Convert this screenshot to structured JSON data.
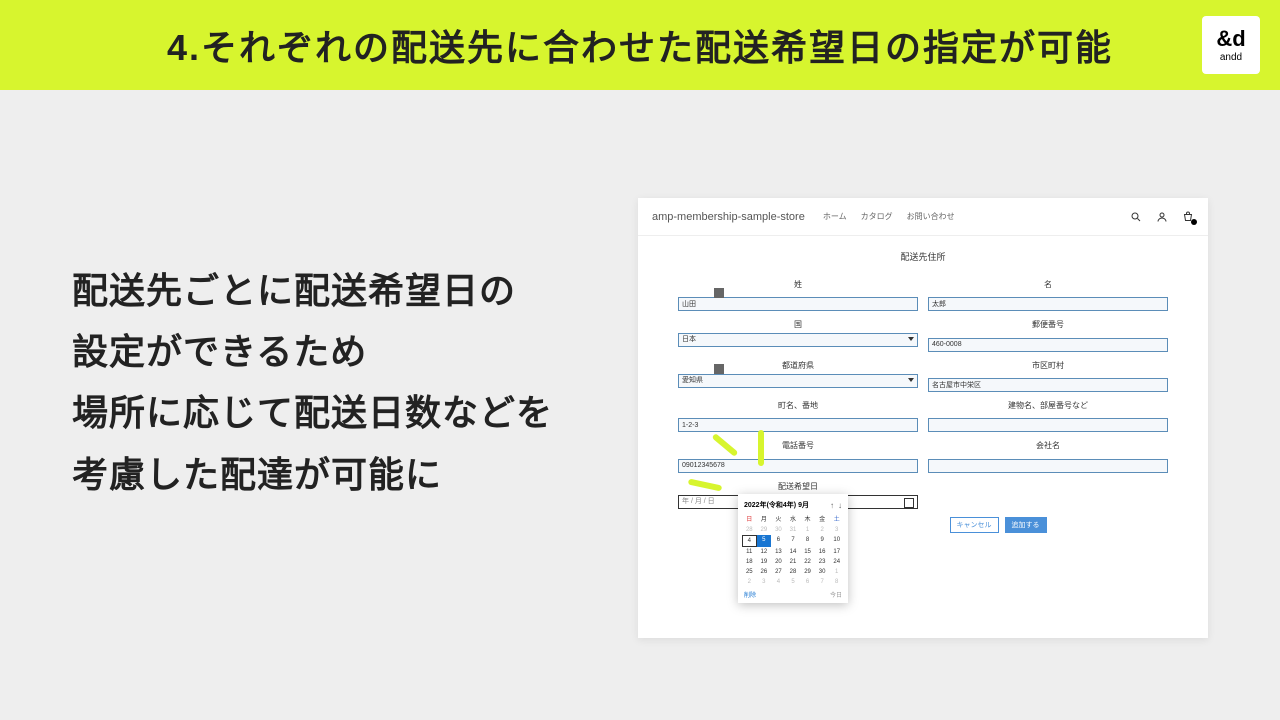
{
  "header": {
    "title": "4.それぞれの配送先に合わせた配送希望日の指定が可能"
  },
  "logo": {
    "mark": "&d",
    "sub": "andd"
  },
  "bodyText": "配送先ごとに配送希望日の\n設定ができるため\n場所に応じて配送日数などを\n考慮した配達が可能に",
  "shot": {
    "storeName": "amp-membership-sample-store",
    "nav": [
      "ホーム",
      "カタログ",
      "お問い合わせ"
    ],
    "formTitle": "配送先住所",
    "labels": {
      "lastName": "姓",
      "firstName": "名",
      "country": "国",
      "postal": "郵便番号",
      "pref": "都道府県",
      "city": "市区町村",
      "street": "町名、番地",
      "building": "建物名、部屋番号など",
      "phone": "電話番号",
      "company": "会社名",
      "deliveryDate": "配送希望日"
    },
    "values": {
      "lastName": "山田",
      "firstName": "太郎",
      "country": "日本",
      "postal": "460-0008",
      "pref": "愛知県",
      "city": "名古屋市中栄区",
      "street": "1-2-3",
      "building": "",
      "phone": "09012345678",
      "company": "",
      "datePlaceholder": "年 / 月 / 日"
    },
    "buttons": {
      "cancel": "キャンセル",
      "submit": "追加する"
    }
  },
  "calendar": {
    "title": "2022年(令和4年) 9月",
    "dow": [
      "日",
      "月",
      "火",
      "水",
      "木",
      "金",
      "土"
    ],
    "weeks": [
      [
        {
          "d": "28",
          "m": 1
        },
        {
          "d": "29",
          "m": 1
        },
        {
          "d": "30",
          "m": 1
        },
        {
          "d": "31",
          "m": 1
        },
        {
          "d": "1",
          "m": 1
        },
        {
          "d": "2",
          "m": 1
        },
        {
          "d": "3",
          "m": 1
        }
      ],
      [
        {
          "d": "4",
          "t": 1
        },
        {
          "d": "5",
          "s": 1
        },
        {
          "d": "6"
        },
        {
          "d": "7"
        },
        {
          "d": "8"
        },
        {
          "d": "9"
        },
        {
          "d": "10"
        }
      ],
      [
        {
          "d": "11"
        },
        {
          "d": "12"
        },
        {
          "d": "13"
        },
        {
          "d": "14"
        },
        {
          "d": "15"
        },
        {
          "d": "16"
        },
        {
          "d": "17"
        }
      ],
      [
        {
          "d": "18"
        },
        {
          "d": "19"
        },
        {
          "d": "20"
        },
        {
          "d": "21"
        },
        {
          "d": "22"
        },
        {
          "d": "23"
        },
        {
          "d": "24"
        }
      ],
      [
        {
          "d": "25"
        },
        {
          "d": "26"
        },
        {
          "d": "27"
        },
        {
          "d": "28"
        },
        {
          "d": "29"
        },
        {
          "d": "30"
        },
        {
          "d": "1",
          "m": 1
        }
      ],
      [
        {
          "d": "2",
          "m": 1
        },
        {
          "d": "3",
          "m": 1
        },
        {
          "d": "4",
          "m": 1
        },
        {
          "d": "5",
          "m": 1
        },
        {
          "d": "6",
          "m": 1
        },
        {
          "d": "7",
          "m": 1
        },
        {
          "d": "8",
          "m": 1
        }
      ]
    ],
    "delete": "削除",
    "today": "今日"
  }
}
